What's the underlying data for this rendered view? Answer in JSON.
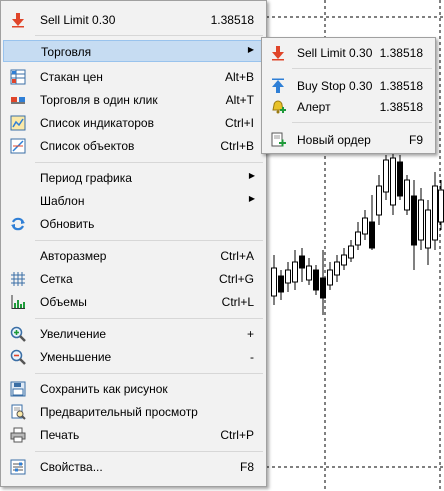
{
  "menu": {
    "header": {
      "label": "Sell Limit 0.30",
      "value": "1.38518",
      "icon": "sell-arrow-icon"
    },
    "items": [
      {
        "label": "Торговля",
        "shortcut": "",
        "icon": ""
      },
      {
        "label": "Стакан цен",
        "shortcut": "Alt+B",
        "icon": "depth-of-market-icon"
      },
      {
        "label": "Торговля в один клик",
        "shortcut": "Alt+T",
        "icon": "one-click-trading-icon"
      },
      {
        "label": "Список индикаторов",
        "shortcut": "Ctrl+I",
        "icon": "indicators-list-icon"
      },
      {
        "label": "Список объектов",
        "shortcut": "Ctrl+B",
        "icon": "objects-list-icon"
      },
      {
        "label": "Период графика",
        "shortcut": "",
        "icon": ""
      },
      {
        "label": "Шаблон",
        "shortcut": "",
        "icon": ""
      },
      {
        "label": "Обновить",
        "shortcut": "",
        "icon": "refresh-icon"
      },
      {
        "label": "Авторазмер",
        "shortcut": "Ctrl+A",
        "icon": "autoscroll-icon"
      },
      {
        "label": "Сетка",
        "shortcut": "Ctrl+G",
        "icon": "grid-icon"
      },
      {
        "label": "Объемы",
        "shortcut": "Ctrl+L",
        "icon": "volumes-icon"
      },
      {
        "label": "Увеличение",
        "shortcut": "+",
        "icon": "zoom-in-icon"
      },
      {
        "label": "Уменьшение",
        "shortcut": "-",
        "icon": "zoom-out-icon"
      },
      {
        "label": "Сохранить как рисунок",
        "shortcut": "",
        "icon": "save-picture-icon"
      },
      {
        "label": "Предварительный просмотр",
        "shortcut": "",
        "icon": "print-preview-icon"
      },
      {
        "label": "Печать",
        "shortcut": "Ctrl+P",
        "icon": "print-icon"
      },
      {
        "label": "Свойства...",
        "shortcut": "F8",
        "icon": "properties-icon"
      }
    ]
  },
  "submenu": {
    "items": [
      {
        "label": "Sell Limit 0.30",
        "value": "1.38518",
        "icon": "sell-arrow-icon"
      },
      {
        "label": "Buy Stop 0.30",
        "value": "1.38518",
        "icon": "buy-arrow-icon"
      },
      {
        "label": "Алерт",
        "value": "1.38518",
        "icon": "alert-bell-icon"
      },
      {
        "label": "Новый ордер",
        "value": "F9",
        "icon": "new-order-icon"
      }
    ]
  },
  "colors": {
    "highlight": "#c6dcf2",
    "menu_bg": "#f2f2f2",
    "sell": "#e0452a",
    "buy": "#2f7fd6"
  }
}
